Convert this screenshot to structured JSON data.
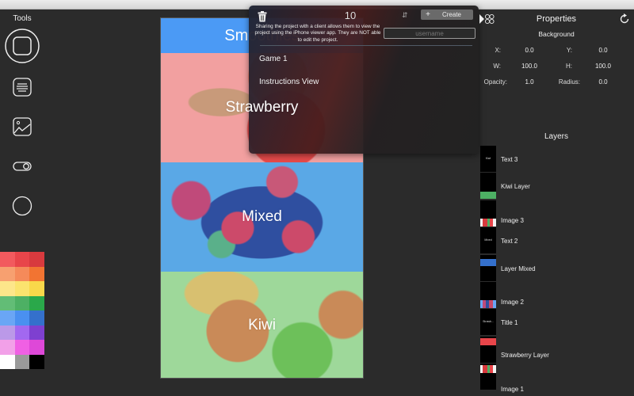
{
  "tools": {
    "title": "Tools",
    "items": [
      {
        "name": "view-tool",
        "icon": "rounded-square-icon",
        "selected": true
      },
      {
        "name": "text-tool",
        "icon": "text-lines-icon"
      },
      {
        "name": "image-tool",
        "icon": "image-icon"
      },
      {
        "name": "switch-tool",
        "icon": "toggle-switch-icon"
      },
      {
        "name": "circle-tool",
        "icon": "circle-icon"
      }
    ],
    "palette": [
      [
        "#f25a5e",
        "#e8454a",
        "#d83a3e"
      ],
      [
        "#f7a070",
        "#f58a5a",
        "#f27432"
      ],
      [
        "#fde68a",
        "#fbe36e",
        "#f9d84a"
      ],
      [
        "#62bd76",
        "#4db064",
        "#2aa84a"
      ],
      [
        "#6aa6f5",
        "#4a90f0",
        "#3470cc"
      ],
      [
        "#bb99e8",
        "#a268f0",
        "#7e40d0"
      ],
      [
        "#f2a0e8",
        "#f060e4",
        "#de48d8"
      ],
      [
        "#ffffff",
        "#9a9a9a",
        "#000000"
      ]
    ]
  },
  "canvas": {
    "nav_title": "Smoothies",
    "sections": [
      {
        "label": "Strawberry",
        "overlay_color": "#f25a5e"
      },
      {
        "label": "Mixed",
        "overlay_color": "#4a90f0"
      },
      {
        "label": "Kiwi",
        "overlay_color": "#4db064"
      }
    ],
    "nav_color": "#4b9af5"
  },
  "popover": {
    "count": "10",
    "create_label": "Create",
    "description": "Sharing the project with a client allows them to view the project using the iPhone viewer app. They are NOT able to edit the project.",
    "username_placeholder": "username",
    "items": [
      "Game 1",
      "Instructions View"
    ]
  },
  "properties": {
    "title": "Properties",
    "section": "Background",
    "fields": {
      "x_label": "X:",
      "x": "0.0",
      "y_label": "Y:",
      "y": "0.0",
      "w_label": "W:",
      "w": "100.0",
      "h_label": "H:",
      "h": "100.0",
      "opacity_label": "Opacity:",
      "opacity": "1.0",
      "radius_label": "Radius:",
      "radius": "0.0"
    }
  },
  "layers": {
    "title": "Layers",
    "items": [
      {
        "name": "Text 3",
        "thumb": "text",
        "thumb_text": "Kiwi"
      },
      {
        "name": "Kiwi Layer",
        "thumb": "color",
        "color": "#4db064"
      },
      {
        "name": "Image 3",
        "thumb": "image"
      },
      {
        "name": "Text 2",
        "thumb": "text",
        "thumb_text": "Mixed"
      },
      {
        "name": "Layer Mixed",
        "thumb": "color",
        "color": "#3470cc"
      },
      {
        "name": "Image 2",
        "thumb": "image"
      },
      {
        "name": "Title 1",
        "thumb": "text",
        "thumb_text": "Strawb..."
      },
      {
        "name": "Strawberry Layer",
        "thumb": "color",
        "color": "#e8454a"
      },
      {
        "name": "Image 1",
        "thumb": "image"
      }
    ]
  }
}
